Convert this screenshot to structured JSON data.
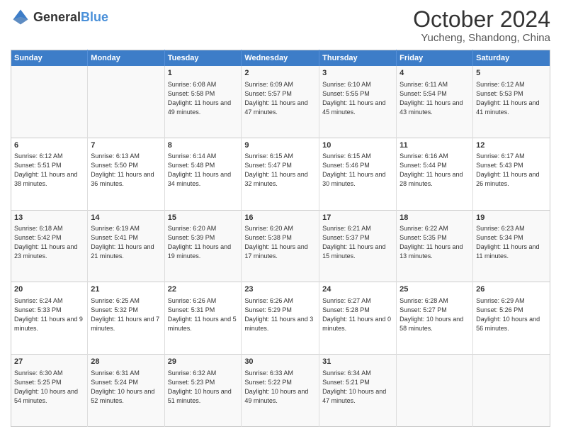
{
  "header": {
    "logo_general": "General",
    "logo_blue": "Blue",
    "title": "October 2024",
    "subtitle": "Yucheng, Shandong, China"
  },
  "days_of_week": [
    "Sunday",
    "Monday",
    "Tuesday",
    "Wednesday",
    "Thursday",
    "Friday",
    "Saturday"
  ],
  "weeks": [
    [
      {
        "day": "",
        "info": ""
      },
      {
        "day": "",
        "info": ""
      },
      {
        "day": "1",
        "info": "Sunrise: 6:08 AM\nSunset: 5:58 PM\nDaylight: 11 hours and 49 minutes."
      },
      {
        "day": "2",
        "info": "Sunrise: 6:09 AM\nSunset: 5:57 PM\nDaylight: 11 hours and 47 minutes."
      },
      {
        "day": "3",
        "info": "Sunrise: 6:10 AM\nSunset: 5:55 PM\nDaylight: 11 hours and 45 minutes."
      },
      {
        "day": "4",
        "info": "Sunrise: 6:11 AM\nSunset: 5:54 PM\nDaylight: 11 hours and 43 minutes."
      },
      {
        "day": "5",
        "info": "Sunrise: 6:12 AM\nSunset: 5:53 PM\nDaylight: 11 hours and 41 minutes."
      }
    ],
    [
      {
        "day": "6",
        "info": "Sunrise: 6:12 AM\nSunset: 5:51 PM\nDaylight: 11 hours and 38 minutes."
      },
      {
        "day": "7",
        "info": "Sunrise: 6:13 AM\nSunset: 5:50 PM\nDaylight: 11 hours and 36 minutes."
      },
      {
        "day": "8",
        "info": "Sunrise: 6:14 AM\nSunset: 5:48 PM\nDaylight: 11 hours and 34 minutes."
      },
      {
        "day": "9",
        "info": "Sunrise: 6:15 AM\nSunset: 5:47 PM\nDaylight: 11 hours and 32 minutes."
      },
      {
        "day": "10",
        "info": "Sunrise: 6:15 AM\nSunset: 5:46 PM\nDaylight: 11 hours and 30 minutes."
      },
      {
        "day": "11",
        "info": "Sunrise: 6:16 AM\nSunset: 5:44 PM\nDaylight: 11 hours and 28 minutes."
      },
      {
        "day": "12",
        "info": "Sunrise: 6:17 AM\nSunset: 5:43 PM\nDaylight: 11 hours and 26 minutes."
      }
    ],
    [
      {
        "day": "13",
        "info": "Sunrise: 6:18 AM\nSunset: 5:42 PM\nDaylight: 11 hours and 23 minutes."
      },
      {
        "day": "14",
        "info": "Sunrise: 6:19 AM\nSunset: 5:41 PM\nDaylight: 11 hours and 21 minutes."
      },
      {
        "day": "15",
        "info": "Sunrise: 6:20 AM\nSunset: 5:39 PM\nDaylight: 11 hours and 19 minutes."
      },
      {
        "day": "16",
        "info": "Sunrise: 6:20 AM\nSunset: 5:38 PM\nDaylight: 11 hours and 17 minutes."
      },
      {
        "day": "17",
        "info": "Sunrise: 6:21 AM\nSunset: 5:37 PM\nDaylight: 11 hours and 15 minutes."
      },
      {
        "day": "18",
        "info": "Sunrise: 6:22 AM\nSunset: 5:35 PM\nDaylight: 11 hours and 13 minutes."
      },
      {
        "day": "19",
        "info": "Sunrise: 6:23 AM\nSunset: 5:34 PM\nDaylight: 11 hours and 11 minutes."
      }
    ],
    [
      {
        "day": "20",
        "info": "Sunrise: 6:24 AM\nSunset: 5:33 PM\nDaylight: 11 hours and 9 minutes."
      },
      {
        "day": "21",
        "info": "Sunrise: 6:25 AM\nSunset: 5:32 PM\nDaylight: 11 hours and 7 minutes."
      },
      {
        "day": "22",
        "info": "Sunrise: 6:26 AM\nSunset: 5:31 PM\nDaylight: 11 hours and 5 minutes."
      },
      {
        "day": "23",
        "info": "Sunrise: 6:26 AM\nSunset: 5:29 PM\nDaylight: 11 hours and 3 minutes."
      },
      {
        "day": "24",
        "info": "Sunrise: 6:27 AM\nSunset: 5:28 PM\nDaylight: 11 hours and 0 minutes."
      },
      {
        "day": "25",
        "info": "Sunrise: 6:28 AM\nSunset: 5:27 PM\nDaylight: 10 hours and 58 minutes."
      },
      {
        "day": "26",
        "info": "Sunrise: 6:29 AM\nSunset: 5:26 PM\nDaylight: 10 hours and 56 minutes."
      }
    ],
    [
      {
        "day": "27",
        "info": "Sunrise: 6:30 AM\nSunset: 5:25 PM\nDaylight: 10 hours and 54 minutes."
      },
      {
        "day": "28",
        "info": "Sunrise: 6:31 AM\nSunset: 5:24 PM\nDaylight: 10 hours and 52 minutes."
      },
      {
        "day": "29",
        "info": "Sunrise: 6:32 AM\nSunset: 5:23 PM\nDaylight: 10 hours and 51 minutes."
      },
      {
        "day": "30",
        "info": "Sunrise: 6:33 AM\nSunset: 5:22 PM\nDaylight: 10 hours and 49 minutes."
      },
      {
        "day": "31",
        "info": "Sunrise: 6:34 AM\nSunset: 5:21 PM\nDaylight: 10 hours and 47 minutes."
      },
      {
        "day": "",
        "info": ""
      },
      {
        "day": "",
        "info": ""
      }
    ]
  ]
}
